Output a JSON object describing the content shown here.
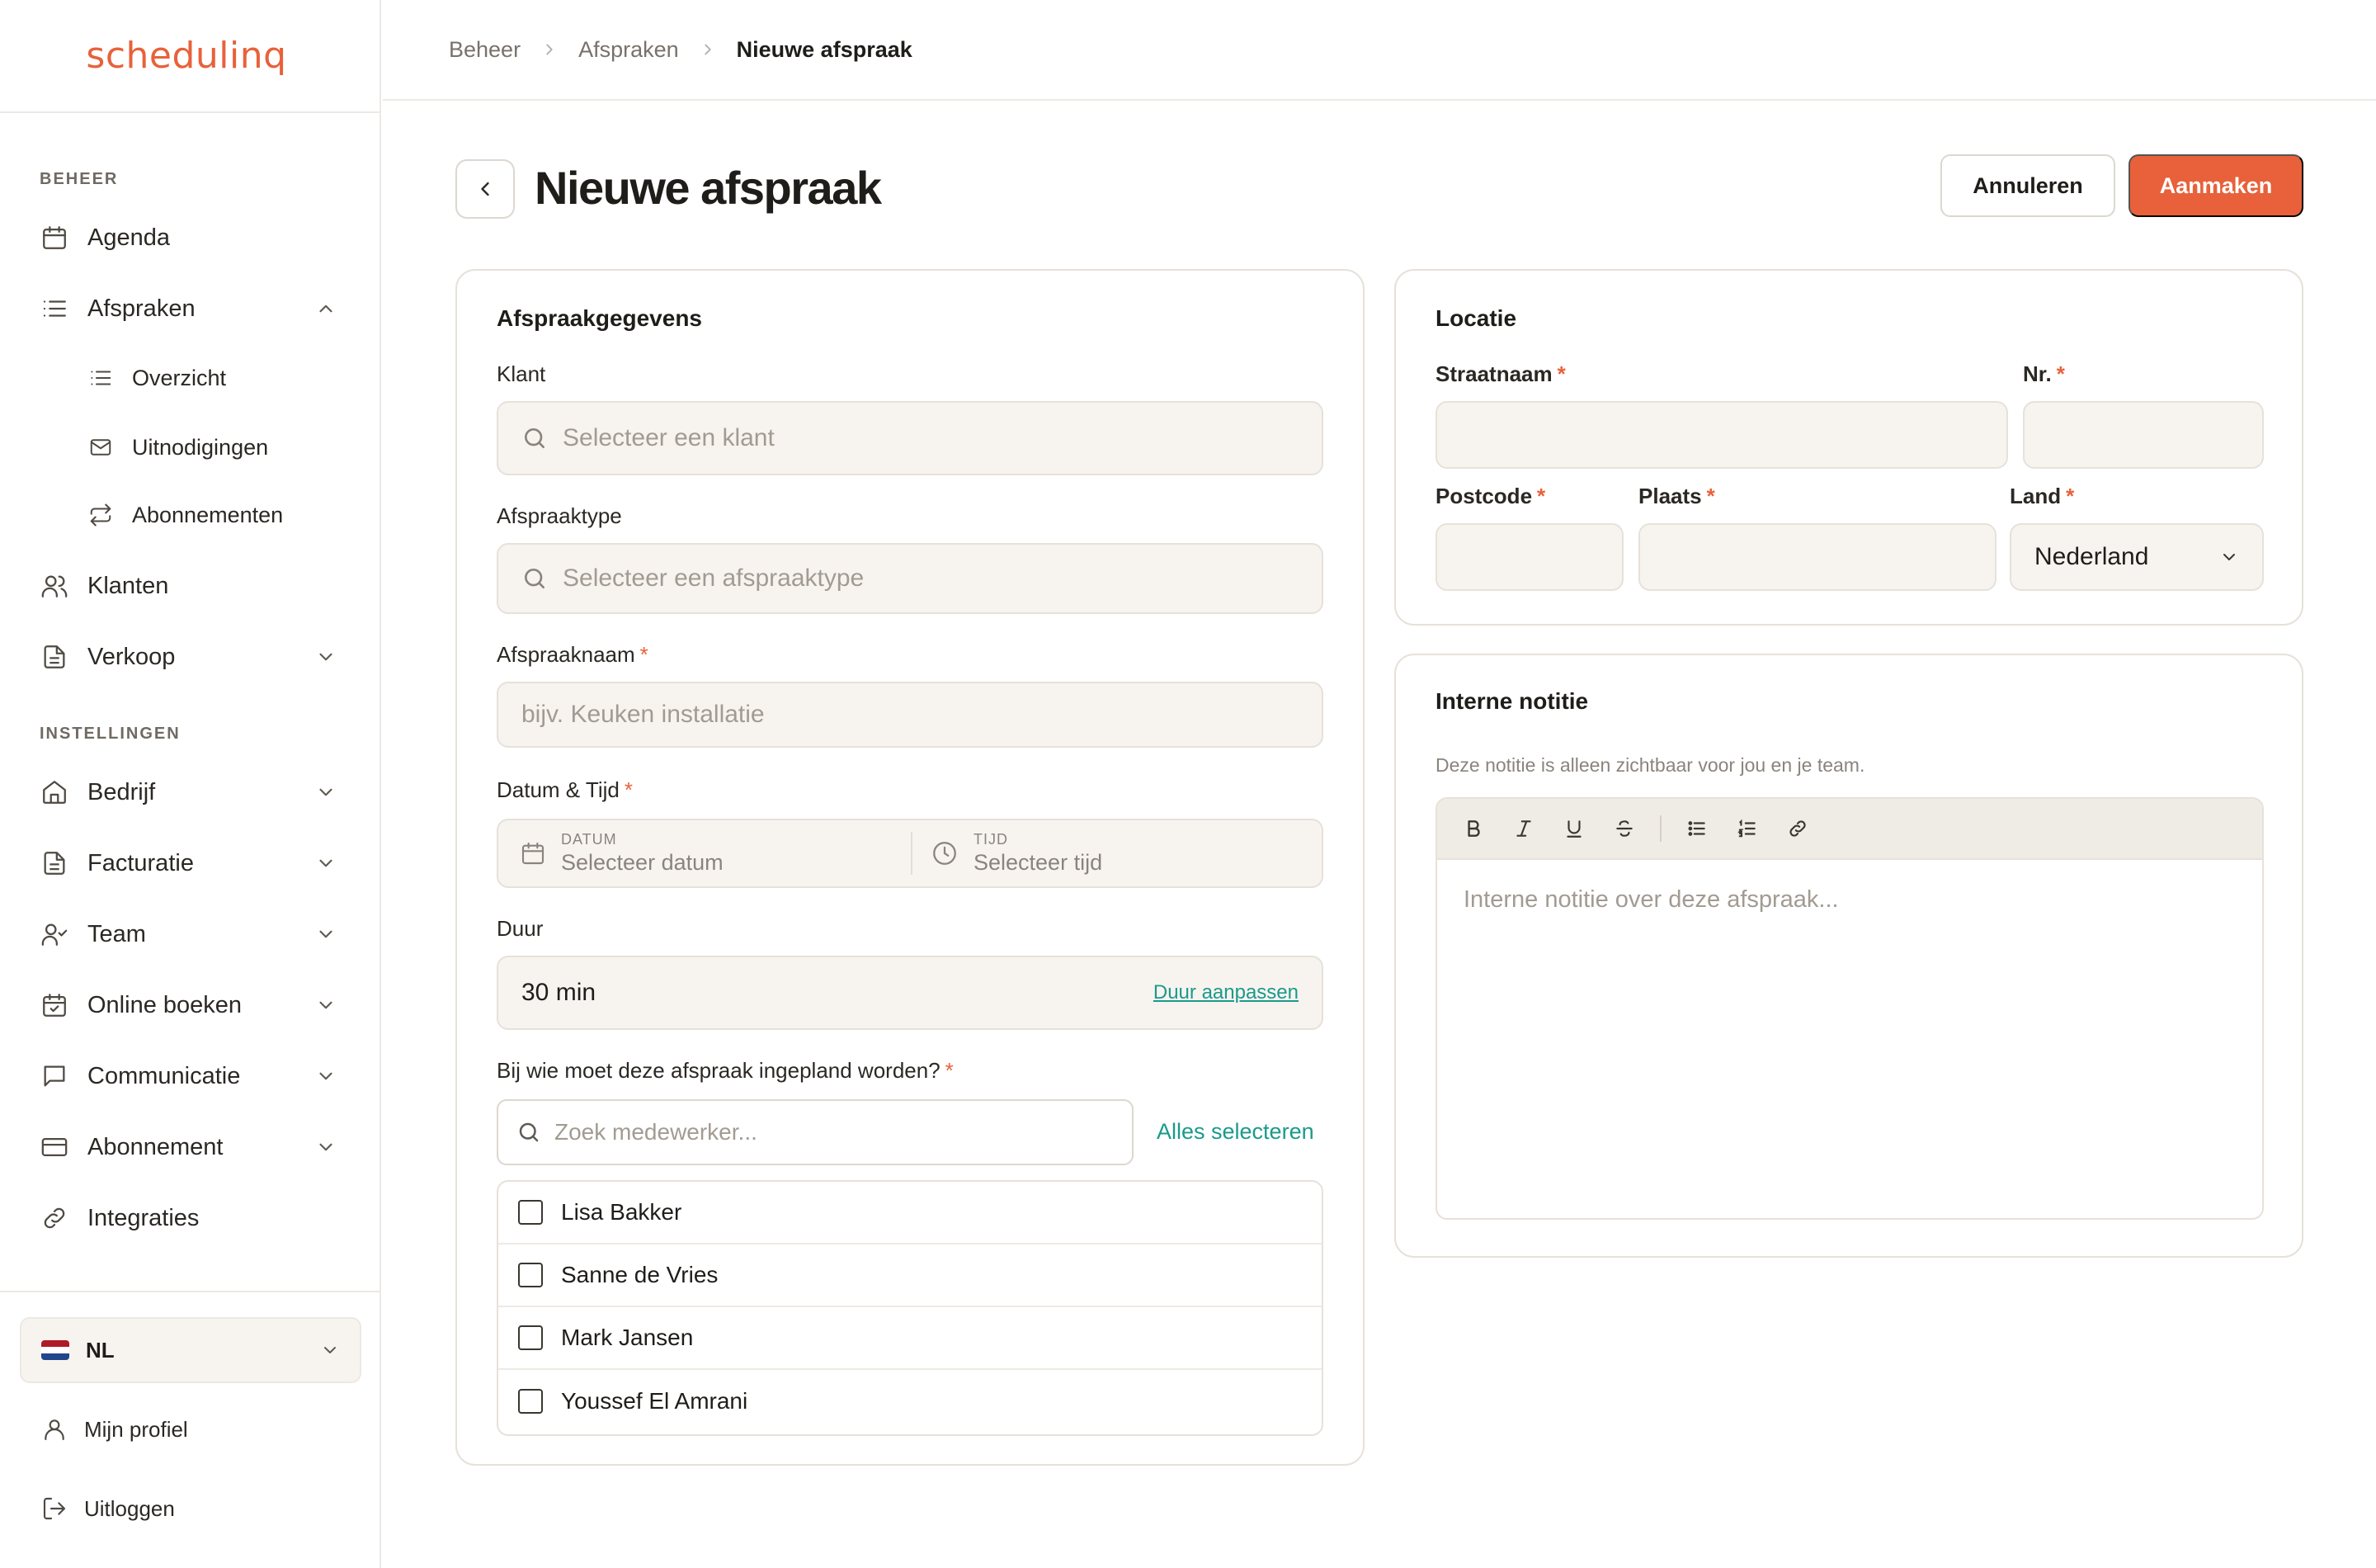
{
  "app": {
    "logo": "schedulinq",
    "brand_color": "#e8613a",
    "teal_color": "#1a9a8a"
  },
  "sidebar": {
    "section_beheer": "BEHEER",
    "section_instellingen": "INSTELLINGEN",
    "items": [
      {
        "label": "Agenda",
        "icon": "calendar-icon"
      },
      {
        "label": "Afspraken",
        "icon": "list-icon",
        "expanded": true
      },
      {
        "label": "Overzicht",
        "icon": "list-icon"
      },
      {
        "label": "Uitnodigingen",
        "icon": "mail-icon"
      },
      {
        "label": "Abonnementen",
        "icon": "repeat-icon"
      },
      {
        "label": "Klanten",
        "icon": "users-icon"
      },
      {
        "label": "Verkoop",
        "icon": "document-icon"
      },
      {
        "label": "Bedrijf",
        "icon": "home-icon"
      },
      {
        "label": "Facturatie",
        "icon": "document-icon"
      },
      {
        "label": "Team",
        "icon": "user-check-icon"
      },
      {
        "label": "Online boeken",
        "icon": "calendar-check-icon"
      },
      {
        "label": "Communicatie",
        "icon": "chat-icon"
      },
      {
        "label": "Abonnement",
        "icon": "credit-card-icon"
      },
      {
        "label": "Integraties",
        "icon": "link-icon"
      }
    ],
    "language": "NL",
    "profile": "Mijn profiel",
    "logout": "Uitloggen"
  },
  "breadcrumb": [
    "Beheer",
    "Afspraken",
    "Nieuwe afspraak"
  ],
  "header": {
    "title": "Nieuwe afspraak",
    "cancel_label": "Annuleren",
    "create_label": "Aanmaken"
  },
  "appointment": {
    "title": "Afspraakgegevens",
    "client_label": "Klant",
    "client_placeholder": "Selecteer een klant",
    "type_label": "Afspraaktype",
    "type_placeholder": "Selecteer een afspraaktype",
    "name_label": "Afspraaknaam",
    "name_placeholder": "bijv. Keuken installatie",
    "datetime_label": "Datum & Tijd",
    "date_small": "DATUM",
    "date_placeholder": "Selecteer datum",
    "time_small": "TIJD",
    "time_placeholder": "Selecteer tijd",
    "duration_label": "Duur",
    "duration_value": "30 min",
    "duration_link": "Duur aanpassen",
    "assign_label": "Bij wie moet deze afspraak ingepland worden?",
    "employee_search_placeholder": "Zoek medewerker...",
    "select_all": "Alles selecteren",
    "employees": [
      {
        "name": "Lisa Bakker",
        "checked": false
      },
      {
        "name": "Sanne de Vries",
        "checked": false
      },
      {
        "name": "Mark Jansen",
        "checked": false
      },
      {
        "name": "Youssef El Amrani",
        "checked": false
      }
    ],
    "required_mark": "*"
  },
  "location": {
    "title": "Locatie",
    "street_label": "Straatnaam",
    "number_label": "Nr.",
    "postcode_label": "Postcode",
    "city_label": "Plaats",
    "country_label": "Land",
    "country_value": "Nederland"
  },
  "note": {
    "title": "Interne notitie",
    "help": "Deze notitie is alleen zichtbaar voor jou en je team.",
    "placeholder": "Interne notitie over deze afspraak..."
  }
}
